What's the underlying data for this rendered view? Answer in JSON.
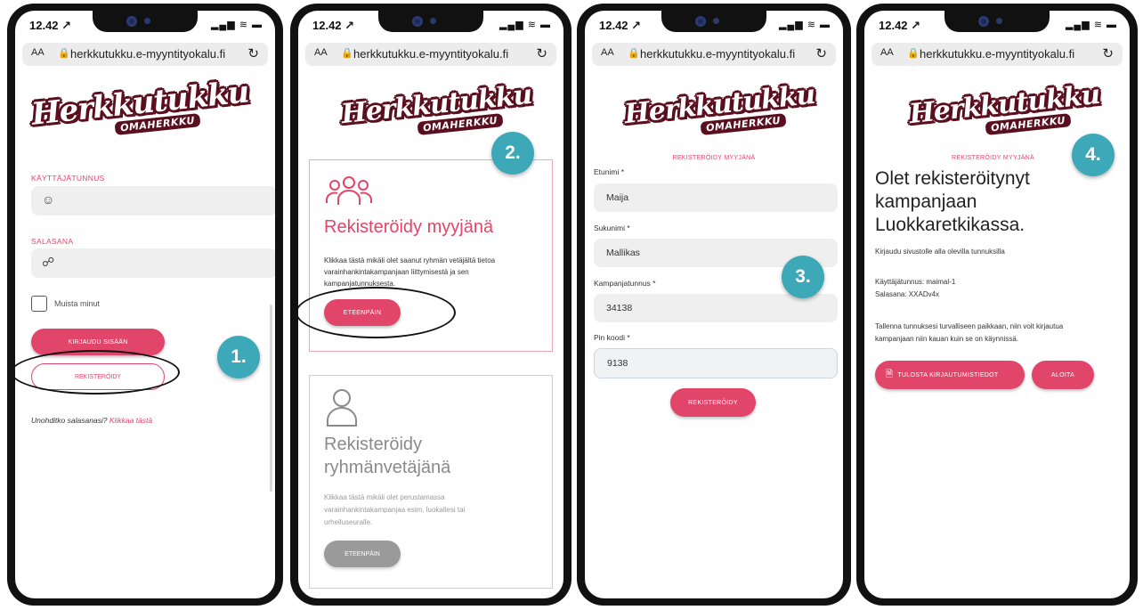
{
  "status": {
    "time": "12.42 ↗",
    "icons": "▂▄▆ ≋ ▬"
  },
  "browser": {
    "aa": "AA",
    "url": "herkkutukku.e-myyntityokalu.fi",
    "lock": "🔒",
    "reload": "↻"
  },
  "logo": {
    "main": "Herkkutukku",
    "sub": "OMAHERKKU"
  },
  "screen1": {
    "username_label": "KÄYTTÄJÄTUNNUS",
    "password_label": "SALASANA",
    "remember_label": "Muista minut",
    "login_button": "KIRJAUDU SISÄÄN",
    "register_button": "REKISTERÖIDY",
    "forgot_prefix": "Unohditko salasanasi? ",
    "forgot_link": "Klikkaa tästä"
  },
  "screen2": {
    "seller_title": "Rekisteröidy myyjänä",
    "seller_text": "Klikkaa tästä mikäli olet saanut ryhmän vetäjältä tietoa varainhankintakampanjaan liittymisestä ja sen kampanjatunnuksesta.",
    "seller_button": "ETEENPÄIN",
    "leader_title": "Rekisteröidy ryhmänvetäjänä",
    "leader_text": "Klikkaa tästä mikäli olet perustamassa varainhankintakampanjaa esim. luokallesi tai urheiluseuralle.",
    "leader_button": "ETEENPÄIN"
  },
  "screen3": {
    "header": "REKISTERÖIDY MYYJÄNÄ",
    "firstname_label": "Etunimi *",
    "firstname_value": "Maija",
    "lastname_label": "Sukunimi *",
    "lastname_value": "Mallikas",
    "campaign_label": "Kampanjatunnus *",
    "campaign_value": "34138",
    "pin_label": "Pin koodi *",
    "pin_value": "9138",
    "register_button": "REKISTERÖIDY"
  },
  "screen4": {
    "header": "REKISTERÖIDY MYYJÄNÄ",
    "title": "Olet rekisteröitynyt kampanjaan Luokkaretkikassa.",
    "subtitle": "Kirjaudu sivustolle alla olevilla tunnuksilla",
    "username_line": "Käyttäjätunnus: maimal-1",
    "password_line": "Salasana: XXADv4x",
    "note": "Tallenna tunnuksesi turvalliseen paikkaan, niin voit kirjautua kampanjaan niin kauan kuin se on käynnissä.",
    "print_button": "TULOSTA KIRJAUTUMISTIEDOT",
    "start_button": "ALOITA"
  },
  "badges": {
    "b1": "1.",
    "b2": "2.",
    "b3": "3.",
    "b4": "4."
  }
}
